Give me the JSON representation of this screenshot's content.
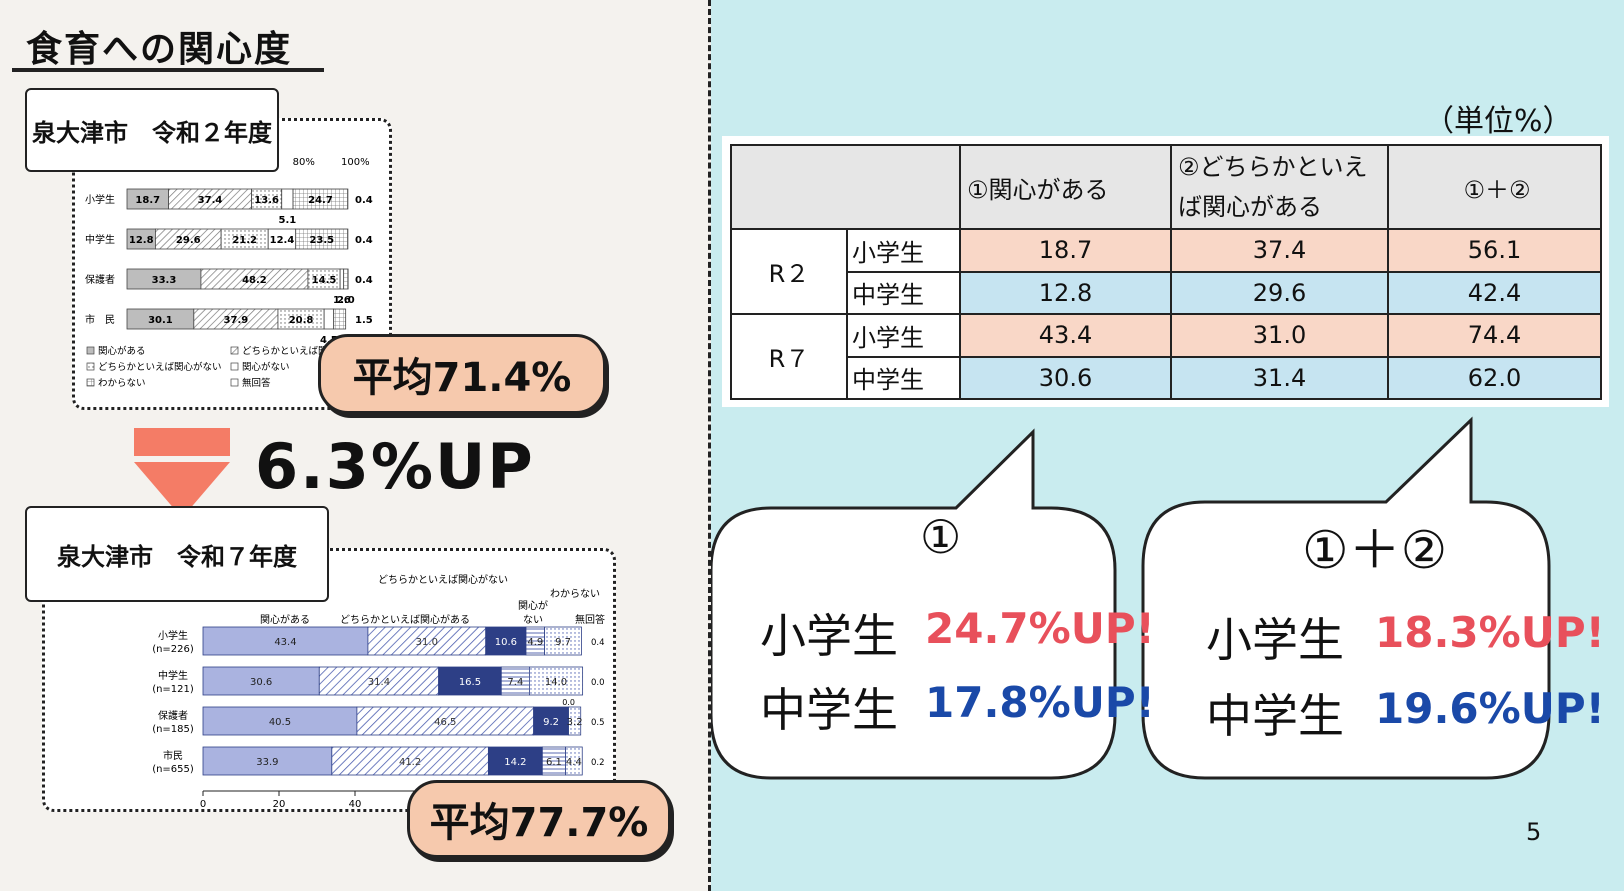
{
  "title": "食育への関心度",
  "r2_label": "泉大津市　令和２年度",
  "r7_label": "泉大津市　令和７年度",
  "avg_r2": "平均71.4%",
  "avg_r7": "平均77.7%",
  "up_text": "6.3%UP",
  "unit": "（単位%）",
  "page_number": "5",
  "colors": {
    "accent_pink": "#e8505b",
    "accent_blue": "#1a49a8",
    "pill": "#f6c9ad",
    "arrow": "#f47c66",
    "bar_dark": "#2d3f86",
    "bar_light": "#aab3e0"
  },
  "table": {
    "headers": [
      "",
      "①関心がある",
      "②どちらかといえば関心がある",
      "①＋②"
    ],
    "rows": [
      {
        "year": "R２",
        "group": "小学生",
        "v1": "18.7",
        "v2": "37.4",
        "sum": "56.1"
      },
      {
        "year": "",
        "group": "中学生",
        "v1": "12.8",
        "v2": "29.6",
        "sum": "42.4"
      },
      {
        "year": "R７",
        "group": "小学生",
        "v1": "43.4",
        "v2": "31.0",
        "sum": "74.4"
      },
      {
        "year": "",
        "group": "中学生",
        "v1": "30.6",
        "v2": "31.4",
        "sum": "62.0"
      }
    ]
  },
  "bubble1": {
    "title": "①",
    "elem_label": "小学生",
    "elem_val": "24.7%UP!",
    "mid_label": "中学生",
    "mid_val": "17.8%UP!"
  },
  "bubble2": {
    "title": "①＋②",
    "elem_label": "小学生",
    "elem_val": "18.3%UP!",
    "mid_label": "中学生",
    "mid_val": "19.6%UP!"
  },
  "chart_data": [
    {
      "type": "bar",
      "stacked": true,
      "orientation": "horizontal",
      "title": "泉大津市　令和２年度",
      "categories": [
        "小学生",
        "中学生",
        "保護者",
        "市　民"
      ],
      "tick_labels_top": [
        "80%",
        "100%"
      ],
      "series": [
        {
          "name": "関心がある",
          "values": [
            18.7,
            12.8,
            33.3,
            30.1
          ]
        },
        {
          "name": "どちらかといえば関心がある",
          "values": [
            37.4,
            29.6,
            48.2,
            37.9
          ]
        },
        {
          "name": "どちらかといえば関心がない",
          "values": [
            13.6,
            21.2,
            14.5,
            20.8
          ]
        },
        {
          "name": "関心がない",
          "values": [
            5.1,
            12.4,
            1.6,
            4.3
          ]
        },
        {
          "name": "わからない",
          "values": [
            24.7,
            23.5,
            2.0,
            5.4
          ]
        },
        {
          "name": "無回答",
          "values": [
            0.4,
            0.4,
            0.4,
            1.5
          ]
        }
      ],
      "legend": [
        "関心がある",
        "どちらかといえば関心がある",
        "どちらかといえば関心がない",
        "関心がない",
        "わからない",
        "無回答"
      ]
    },
    {
      "type": "bar",
      "stacked": true,
      "orientation": "horizontal",
      "title": "泉大津市　令和７年度",
      "categories": [
        "小学生",
        "中学生",
        "保護者",
        "市民"
      ],
      "category_counts": [
        "(n=226)",
        "(n=121)",
        "(n=185)",
        "(n=655)"
      ],
      "series_headers": [
        "関心がある",
        "どちらかといえば関心がある",
        "どちらかといえば関心がない",
        "関心がない",
        "わからない",
        "無回答"
      ],
      "header_texts": {
        "top": "どちらかといえば関心がない",
        "wakaranai": "わからない",
        "kanshin_nai": "関心が\nない",
        "muka": "無回答"
      },
      "series": [
        {
          "name": "関心がある",
          "values": [
            43.4,
            30.6,
            40.5,
            33.9
          ]
        },
        {
          "name": "どちらかといえば関心がある",
          "values": [
            31.0,
            31.4,
            46.5,
            41.2
          ]
        },
        {
          "name": "どちらかといえば関心がない",
          "values": [
            10.6,
            16.5,
            9.2,
            14.2
          ]
        },
        {
          "name": "関心がない",
          "values": [
            4.9,
            7.4,
            0.0,
            6.1
          ]
        },
        {
          "name": "わからない",
          "values": [
            9.7,
            14.0,
            3.2,
            4.4
          ]
        },
        {
          "name": "無回答",
          "values": [
            0.4,
            0.0,
            0.5,
            0.2
          ]
        }
      ],
      "x_ticks": [
        "0",
        "20",
        "40"
      ],
      "xlim": [
        0,
        100
      ]
    }
  ]
}
